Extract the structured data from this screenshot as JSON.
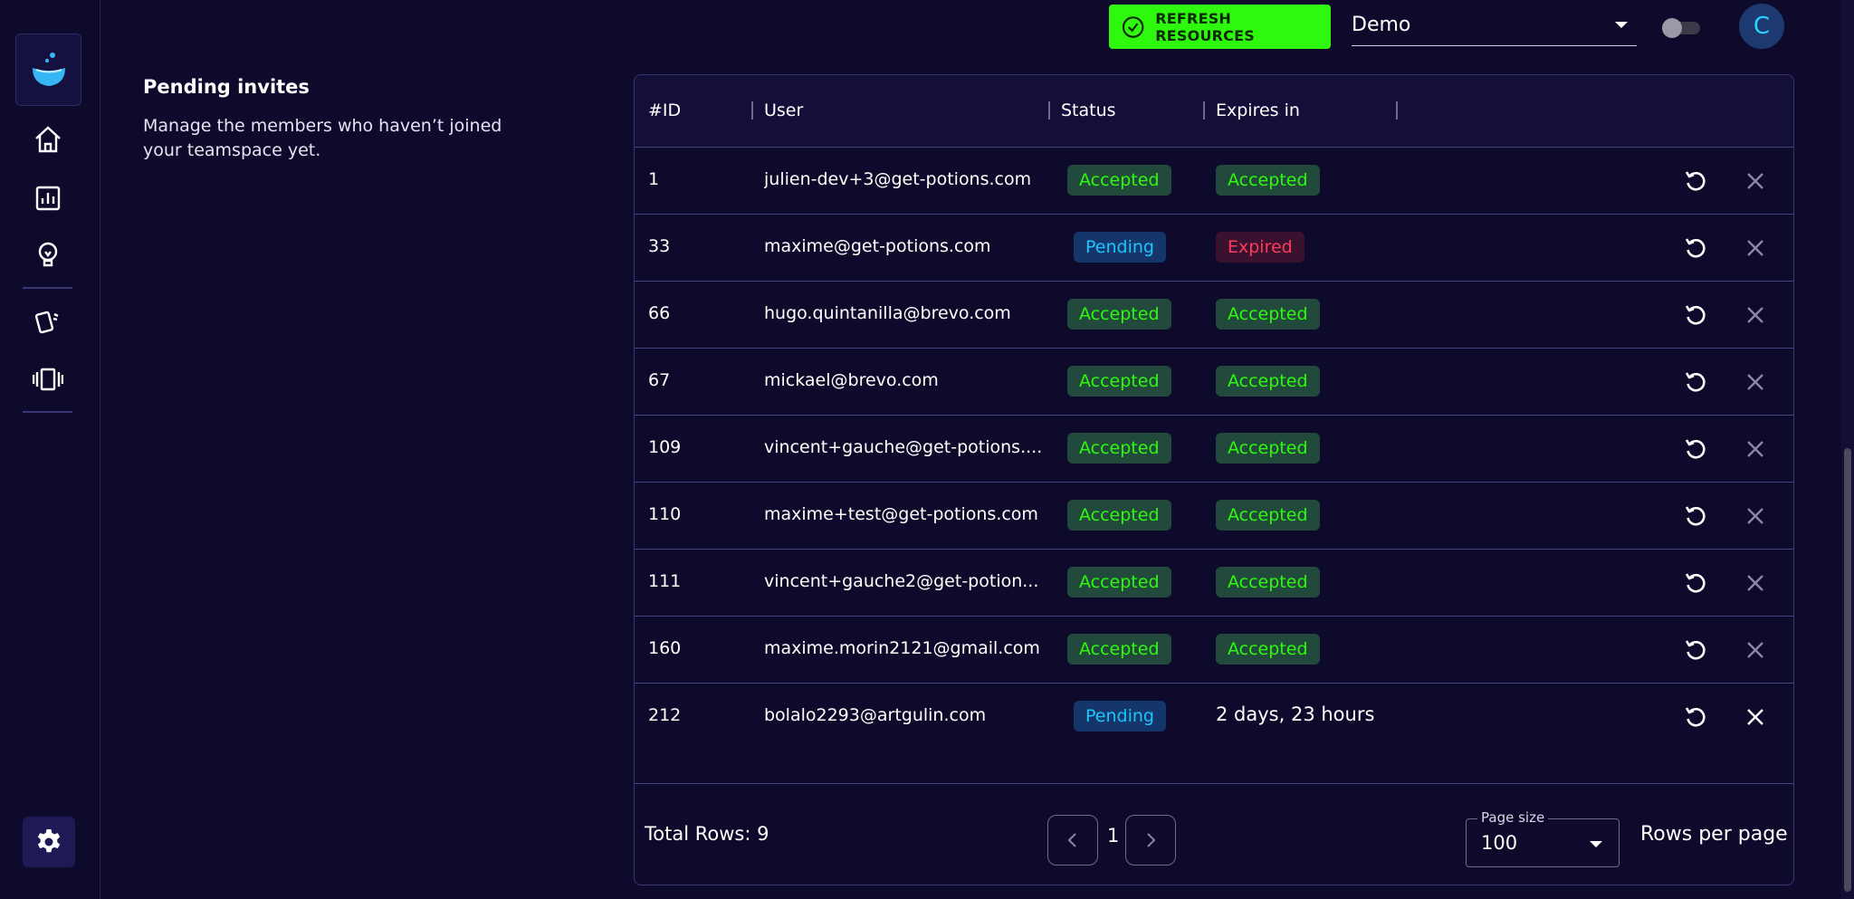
{
  "topbar": {
    "refresh_label": "REFRESH RESOURCES",
    "workspace_value": "Demo",
    "avatar_initial": "C"
  },
  "section": {
    "title": "Pending invites",
    "description": "Manage the members who haven’t joined your teamspace yet."
  },
  "table": {
    "headers": {
      "id": "#ID",
      "user": "User",
      "status": "Status",
      "expires": "Expires in"
    },
    "rows": [
      {
        "id": "1",
        "user": "julien-dev+3@get-potions.com",
        "status": "Accepted",
        "status_kind": "accepted",
        "expires": "Accepted",
        "expires_kind": "accepted"
      },
      {
        "id": "33",
        "user": "maxime@get-potions.com",
        "status": "Pending",
        "status_kind": "pending",
        "expires": "Expired",
        "expires_kind": "expired"
      },
      {
        "id": "66",
        "user": "hugo.quintanilla@brevo.com",
        "status": "Accepted",
        "status_kind": "accepted",
        "expires": "Accepted",
        "expires_kind": "accepted"
      },
      {
        "id": "67",
        "user": "mickael@brevo.com",
        "status": "Accepted",
        "status_kind": "accepted",
        "expires": "Accepted",
        "expires_kind": "accepted"
      },
      {
        "id": "109",
        "user": "vincent+gauche@get-potions....",
        "status": "Accepted",
        "status_kind": "accepted",
        "expires": "Accepted",
        "expires_kind": "accepted"
      },
      {
        "id": "110",
        "user": "maxime+test@get-potions.com",
        "status": "Accepted",
        "status_kind": "accepted",
        "expires": "Accepted",
        "expires_kind": "accepted"
      },
      {
        "id": "111",
        "user": "vincent+gauche2@get-potion...",
        "status": "Accepted",
        "status_kind": "accepted",
        "expires": "Accepted",
        "expires_kind": "accepted"
      },
      {
        "id": "160",
        "user": "maxime.morin2121@gmail.com",
        "status": "Accepted",
        "status_kind": "accepted",
        "expires": "Accepted",
        "expires_kind": "accepted"
      },
      {
        "id": "212",
        "user": "bolalo2293@artgulin.com",
        "status": "Pending",
        "status_kind": "pending",
        "expires": "2 days, 23 hours",
        "expires_kind": "text"
      }
    ]
  },
  "footer": {
    "total_rows": "Total Rows: 9",
    "current_page": "1",
    "page_size_label": "Page size",
    "page_size_value": "100",
    "rows_per_page": "Rows per page"
  },
  "colors": {
    "background": "#0e0a2b",
    "accent_green": "#2ff80f",
    "pending_blue": "#1ac6ff",
    "expired_red": "#ff3a5c"
  },
  "icons": {
    "logo": "water-drop-logo",
    "nav": [
      "home-icon",
      "chart-icon",
      "lightbulb-icon",
      "cards-icon",
      "carousel-icon"
    ],
    "settings": "gear-icon",
    "row_actions": [
      "resend-icon",
      "close-icon"
    ]
  }
}
